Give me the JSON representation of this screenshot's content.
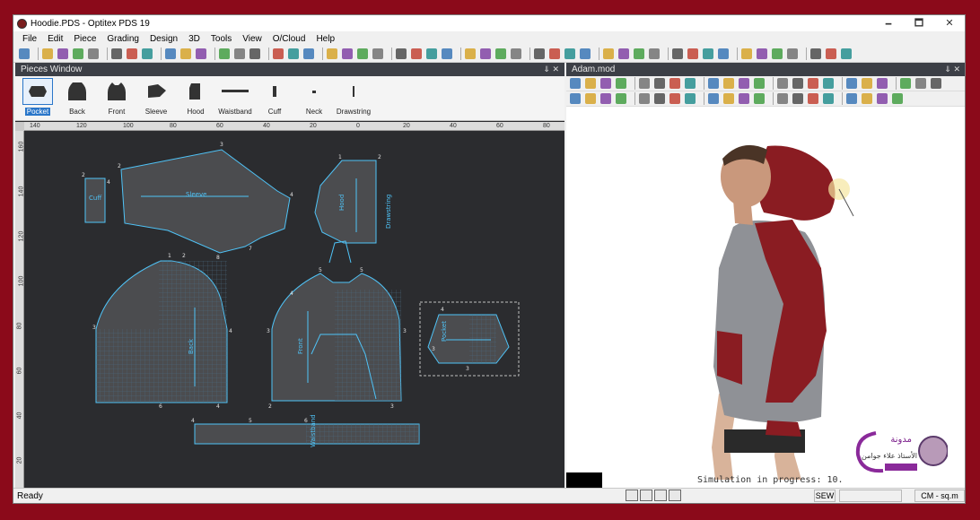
{
  "window": {
    "title": "Hoodie.PDS - Optitex PDS 19",
    "minimize": "🗕",
    "maximize": "🗖",
    "close": "✕"
  },
  "menu": [
    "File",
    "Edit",
    "Piece",
    "Grading",
    "Design",
    "3D",
    "Tools",
    "View",
    "O/Cloud",
    "Help"
  ],
  "pieces_window": {
    "title": "Pieces Window",
    "pin": "⇓ ✕",
    "pieces": [
      {
        "name": "Pocket",
        "selected": true
      },
      {
        "name": "Back"
      },
      {
        "name": "Front"
      },
      {
        "name": "Sleeve"
      },
      {
        "name": "Hood"
      },
      {
        "name": "Waistband"
      },
      {
        "name": "Cuff"
      },
      {
        "name": "Neck"
      },
      {
        "name": "Drawstring"
      }
    ]
  },
  "rulers": {
    "h": [
      "140",
      "120",
      "100",
      "80",
      "60",
      "40",
      "20",
      "0",
      "20",
      "40",
      "60",
      "80"
    ],
    "v": [
      "160",
      "140",
      "120",
      "100",
      "80",
      "60",
      "40",
      "20"
    ]
  },
  "canvas_labels": {
    "cuff": "Cuff",
    "sleeve": "Sleeve",
    "hood": "Hood",
    "back": "Back",
    "front": "Front",
    "pocket": "Pocket",
    "waistband": "Waistband",
    "drawstring": "Drawstring"
  },
  "point_labels": [
    "1",
    "2",
    "3",
    "4",
    "5",
    "6",
    "7",
    "8",
    "9"
  ],
  "view3d": {
    "title": "Adam.mod",
    "pin": "⇓ ✕",
    "simulation_text": "Simulation in progress: 10.",
    "logo_text_1": "مدونة",
    "logo_text_2": "الأستاذ علاء جوامن"
  },
  "status": {
    "ready": "Ready",
    "sew": "SEW",
    "units": "CM - sq.m"
  },
  "colors": {
    "frame": "#8b0a1a",
    "pattern_line": "#4fc3f7",
    "canvas": "#2b2c2f",
    "hoodie_red": "#8a1c22",
    "hoodie_grey": "#8f9196"
  }
}
